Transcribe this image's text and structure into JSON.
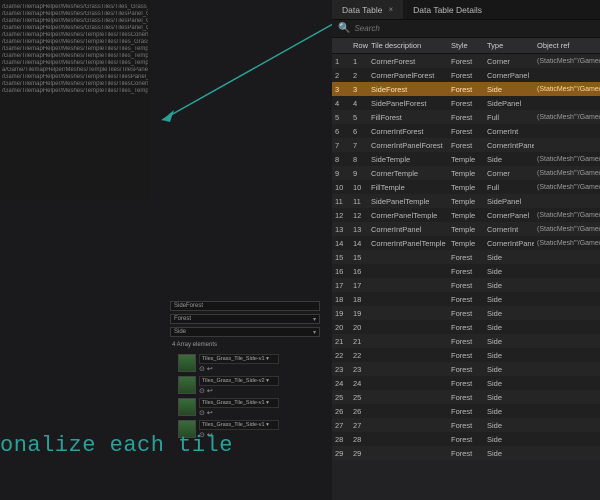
{
  "left_paths": [
    "/Game/TilemapHelper/Meshes/GrassTiles/Tiles_Grass_Tile...",
    "/Game/TilemapHelper/Meshes/GrassTiles/TilesPanel_Gras...",
    "/Game/TilemapHelper/Meshes/GrassTiles/TilesPanel_Grass...",
    "/Game/TilemapHelper/Meshes/GrassTiles/TilesPanel_Gras...",
    "/Game/TilemapHelper/Meshes/TempleTiles/TilesConerIntOr...",
    "/Game/TilemapHelper/Meshes/TempleTiles/Tiles_Grass_Cor...",
    "/Game/TilemapHelper/Meshes/TempleTiles/Tiles_Temple_Si...",
    "/Game/TilemapHelper/Meshes/TempleTiles/Tiles_Temple_Th...",
    "/Game/TilemapHelper/Meshes/TempleTiles/Tiles_Temple_Th...",
    "a/Game/TilemapHelper/Meshes/TempleTiles/TilesPanel_Tem...",
    "/Game/TilemapHelper/Meshes/TempleTiles/TilesPanel_Tem...",
    "/Game/TilemapHelper/Meshes/TempleTiles/TilesConerIntTe...",
    "/Game/TilemapHelper/Meshes/TempleTiles/Tiles_Temple_..."
  ],
  "details": {
    "name": "SideForest",
    "style": "Forest",
    "side": "Side",
    "array_label": "4 Array elements",
    "items": [
      "Tiles_Grass_Tile_Side-v1",
      "Tiles_Grass_Tile_Side-v2",
      "Tiles_Grass_Tile_Side-v1",
      "Tiles_Grass_Tile_Side-v1"
    ]
  },
  "tabs": {
    "active": "Data Table",
    "other": "Data Table Details"
  },
  "search_placeholder": "Search",
  "columns": [
    "",
    "Row",
    "Tile description",
    "Style",
    "Type",
    "Object ref"
  ],
  "rows": [
    {
      "n": 1,
      "r": 1,
      "desc": "CornerForest",
      "style": "Forest",
      "type": "Corner",
      "obj": "(StaticMesh'\"/Game/TilemapHelp"
    },
    {
      "n": 2,
      "r": 2,
      "desc": "CornerPanelForest",
      "style": "Forest",
      "type": "CornerPanel",
      "obj": ""
    },
    {
      "n": 3,
      "r": 3,
      "desc": "SideForest",
      "style": "Forest",
      "type": "Side",
      "obj": "(StaticMesh'\"/Game/TilemapHelp",
      "sel": true
    },
    {
      "n": 4,
      "r": 4,
      "desc": "SidePanelForest",
      "style": "Forest",
      "type": "SidePanel",
      "obj": ""
    },
    {
      "n": 5,
      "r": 5,
      "desc": "FillForest",
      "style": "Forest",
      "type": "Full",
      "obj": "(StaticMesh'\"/Game/TilemapHelp"
    },
    {
      "n": 6,
      "r": 6,
      "desc": "CornerIntForest",
      "style": "Forest",
      "type": "CornerInt",
      "obj": ""
    },
    {
      "n": 7,
      "r": 7,
      "desc": "CornerIntPanelForest",
      "style": "Forest",
      "type": "CornerIntPanel",
      "obj": ""
    },
    {
      "n": 8,
      "r": 8,
      "desc": "SideTemple",
      "style": "Temple",
      "type": "Side",
      "obj": "(StaticMesh'\"/Game/TilemapHelp"
    },
    {
      "n": 9,
      "r": 9,
      "desc": "CornerTemple",
      "style": "Temple",
      "type": "Corner",
      "obj": "(StaticMesh'\"/Game/TilemapHelp"
    },
    {
      "n": 10,
      "r": 10,
      "desc": "FillTemple",
      "style": "Temple",
      "type": "Full",
      "obj": "(StaticMesh'\"/Game/TilemapHelp"
    },
    {
      "n": 11,
      "r": 11,
      "desc": "SidePanelTemple",
      "style": "Temple",
      "type": "SidePanel",
      "obj": ""
    },
    {
      "n": 12,
      "r": 12,
      "desc": "CornerPanelTemple",
      "style": "Temple",
      "type": "CornerPanel",
      "obj": "(StaticMesh'\"/Game/TilemapHelp"
    },
    {
      "n": 13,
      "r": 13,
      "desc": "CornerIntPanel",
      "style": "Temple",
      "type": "CornerInt",
      "obj": "(StaticMesh'\"/Game/TilemapHelp"
    },
    {
      "n": 14,
      "r": 14,
      "desc": "CornerIntPanelTemple",
      "style": "Temple",
      "type": "CornerIntPanel",
      "obj": "(StaticMesh'\"/Game/TilemapHelp"
    },
    {
      "n": 15,
      "r": 15,
      "desc": "",
      "style": "Forest",
      "type": "Side",
      "obj": ""
    },
    {
      "n": 16,
      "r": 16,
      "desc": "",
      "style": "Forest",
      "type": "Side",
      "obj": ""
    },
    {
      "n": 17,
      "r": 17,
      "desc": "",
      "style": "Forest",
      "type": "Side",
      "obj": ""
    },
    {
      "n": 18,
      "r": 18,
      "desc": "",
      "style": "Forest",
      "type": "Side",
      "obj": ""
    },
    {
      "n": 19,
      "r": 19,
      "desc": "",
      "style": "Forest",
      "type": "Side",
      "obj": ""
    },
    {
      "n": 20,
      "r": 20,
      "desc": "",
      "style": "Forest",
      "type": "Side",
      "obj": ""
    },
    {
      "n": 21,
      "r": 21,
      "desc": "",
      "style": "Forest",
      "type": "Side",
      "obj": ""
    },
    {
      "n": 22,
      "r": 22,
      "desc": "",
      "style": "Forest",
      "type": "Side",
      "obj": ""
    },
    {
      "n": 23,
      "r": 23,
      "desc": "",
      "style": "Forest",
      "type": "Side",
      "obj": ""
    },
    {
      "n": 24,
      "r": 24,
      "desc": "",
      "style": "Forest",
      "type": "Side",
      "obj": ""
    },
    {
      "n": 25,
      "r": 25,
      "desc": "",
      "style": "Forest",
      "type": "Side",
      "obj": ""
    },
    {
      "n": 26,
      "r": 26,
      "desc": "",
      "style": "Forest",
      "type": "Side",
      "obj": ""
    },
    {
      "n": 27,
      "r": 27,
      "desc": "",
      "style": "Forest",
      "type": "Side",
      "obj": ""
    },
    {
      "n": 28,
      "r": 28,
      "desc": "",
      "style": "Forest",
      "type": "Side",
      "obj": ""
    },
    {
      "n": 29,
      "r": 29,
      "desc": "",
      "style": "Forest",
      "type": "Side",
      "obj": ""
    }
  ],
  "overlay": "onalize each tile"
}
